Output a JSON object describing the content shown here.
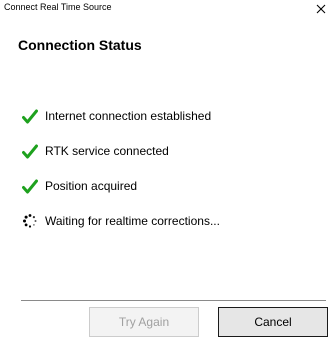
{
  "window": {
    "title": "Connect Real Time Source",
    "close_glyph": "✕"
  },
  "heading": "Connection Status",
  "status_items": [
    {
      "label": "Internet connection established",
      "icon": "check-icon",
      "state": "done"
    },
    {
      "label": "RTK service connected",
      "icon": "check-icon",
      "state": "done"
    },
    {
      "label": "Position acquired",
      "icon": "check-icon",
      "state": "done"
    },
    {
      "label": "Waiting for realtime corrections...",
      "icon": "spinner-icon",
      "state": "pending"
    }
  ],
  "buttons": {
    "try_again": "Try Again",
    "cancel": "Cancel"
  },
  "colors": {
    "check": "#1ea11e",
    "disabled_text": "#a0a0a0"
  }
}
